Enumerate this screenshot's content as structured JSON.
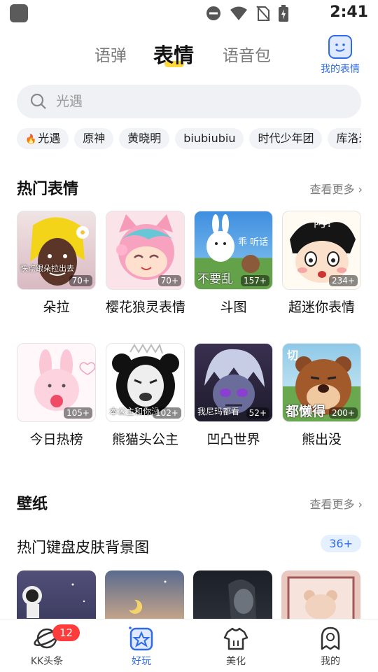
{
  "status": {
    "time": "2:41"
  },
  "tabs": [
    {
      "label": "语弹",
      "active": false
    },
    {
      "label": "表情",
      "active": true
    },
    {
      "label": "语音包",
      "active": false
    }
  ],
  "my_emoji": {
    "label": "我的表情",
    "icon": "emoji-face-icon"
  },
  "search": {
    "placeholder": "光遇"
  },
  "chips": [
    "光遇",
    "原神",
    "黄晓明",
    "biubiubiu",
    "时代少年团",
    "库洛米"
  ],
  "hot": {
    "title": "热门表情",
    "more": "查看更多",
    "items": [
      {
        "name": "朵拉",
        "count": "70+",
        "caption": "快点跟朵拉出去"
      },
      {
        "name": "樱花狼灵表情",
        "count": "70+",
        "caption": ""
      },
      {
        "name": "斗图",
        "count": "157+",
        "caption": "不要乱"
      },
      {
        "name": "超迷你表情",
        "count": "234+",
        "caption": ""
      },
      {
        "name": "今日热榜",
        "count": "105+",
        "caption": ""
      },
      {
        "name": "熊猫头公主",
        "count": "102+",
        "caption": "本公主和你没"
      },
      {
        "name": "凹凸世界",
        "count": "52+",
        "caption": "我尼玛都看"
      },
      {
        "name": "熊出没",
        "count": "200+",
        "caption": "都懒得"
      }
    ]
  },
  "wallpaper": {
    "title": "壁纸",
    "more": "查看更多",
    "subtitle": "热门键盘皮肤背景图",
    "badge": "36+"
  },
  "nav": [
    {
      "label": "KK头条",
      "badge": "12"
    },
    {
      "label": "好玩",
      "active": true
    },
    {
      "label": "美化"
    },
    {
      "label": "我的"
    }
  ],
  "colors": {
    "accent": "#2f6be8",
    "underline": "#ffd83a",
    "badge_red": "#ff3b3b"
  }
}
